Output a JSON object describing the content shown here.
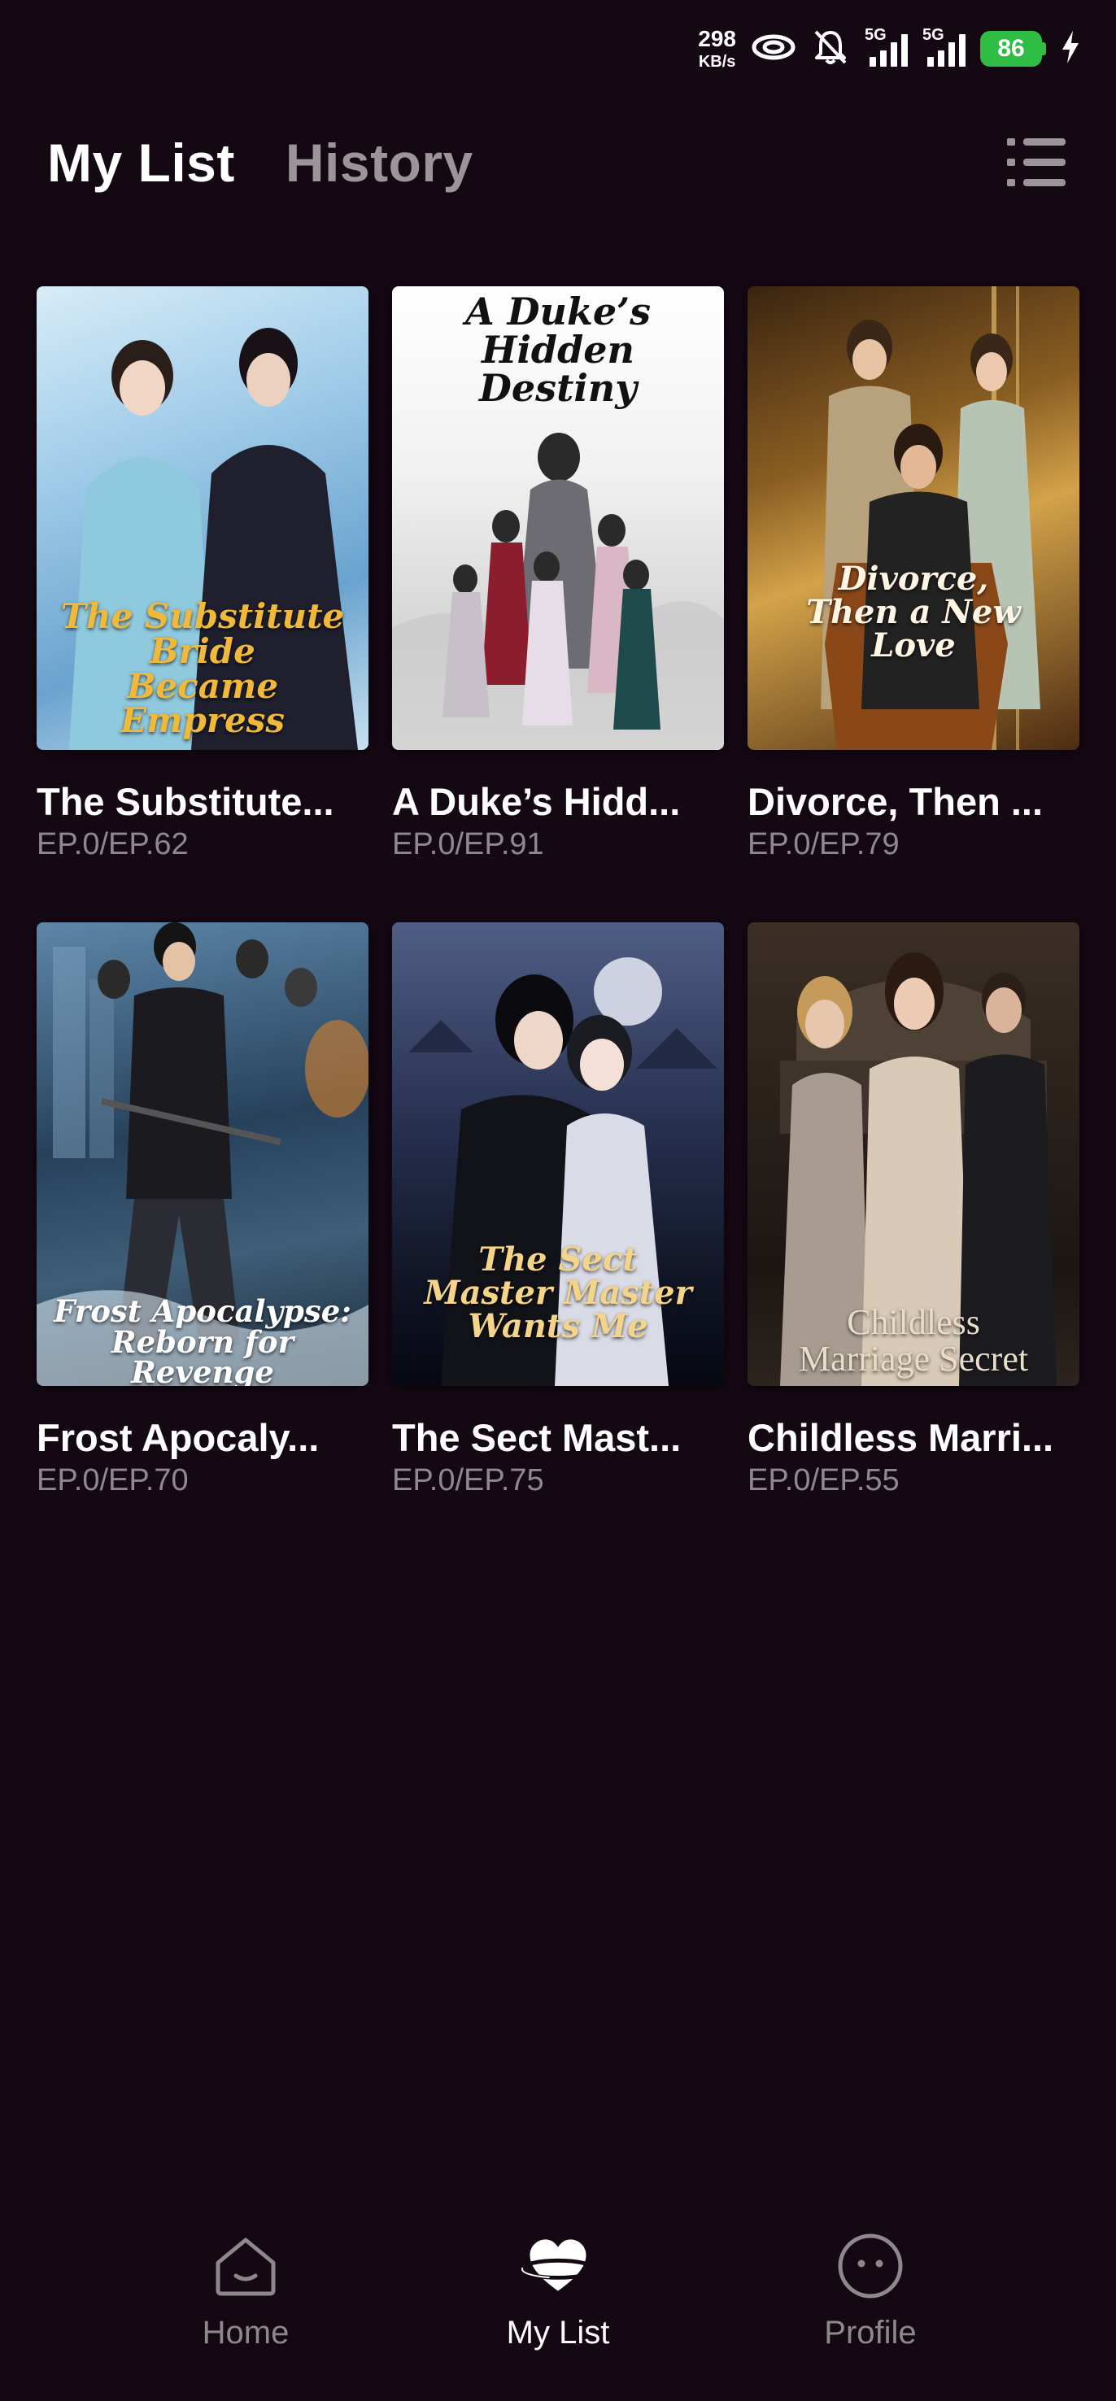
{
  "status_bar": {
    "net_speed_value": "298",
    "net_speed_unit": "KB/s",
    "sim1_type": "5G",
    "sim2_type": "5G",
    "battery_level": "86",
    "icons": [
      "hotspot-icon",
      "mute-bell-icon",
      "signal-icon",
      "signal-icon",
      "battery-icon",
      "charging-bolt-icon"
    ]
  },
  "header": {
    "tab_my_list": "My List",
    "tab_history": "History",
    "menu_icon": "list-menu-icon"
  },
  "items": [
    {
      "title": "The Substitute...",
      "episodes": "EP.0/EP.62",
      "poster_text": "The Substitute Bride\nBecame Empress"
    },
    {
      "title": "A Duke’s Hidd...",
      "episodes": "EP.0/EP.91",
      "poster_text": "A Duke’s\nHidden Destiny"
    },
    {
      "title": "Divorce, Then ...",
      "episodes": "EP.0/EP.79",
      "poster_text": "Divorce,\nThen a New Love"
    },
    {
      "title": "Frost Apocaly...",
      "episodes": "EP.0/EP.70",
      "poster_text": "Frost Apocalypse:\nReborn for Revenge"
    },
    {
      "title": "The Sect Mast...",
      "episodes": "EP.0/EP.75",
      "poster_text": "The Sect\nMaster Master\nWants Me"
    },
    {
      "title": "Childless Marri...",
      "episodes": "EP.0/EP.55",
      "poster_text": "Childless\nMarriage Secret"
    }
  ],
  "bottom_nav": {
    "home": "Home",
    "my_list": "My List",
    "profile": "Profile"
  },
  "colors": {
    "background": "#140812",
    "inactive_text": "#9b9599",
    "battery_green": "#2fbd43"
  }
}
